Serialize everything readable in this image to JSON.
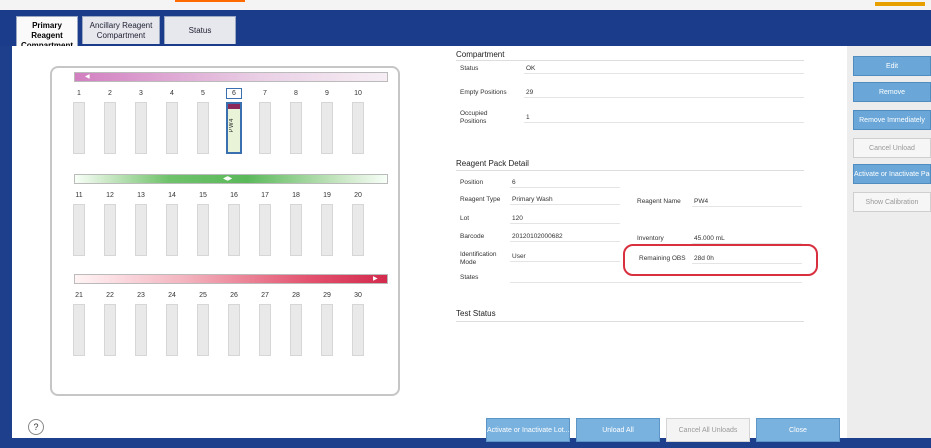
{
  "tabs": [
    {
      "line1": "Primary Reagent",
      "line2": "Compartment",
      "active": true
    },
    {
      "line1": "Ancillary Reagent",
      "line2": "Compartment",
      "active": false
    },
    {
      "line1": "Status",
      "line2": "",
      "active": false
    }
  ],
  "rack": {
    "positions": [
      {
        "n": "1"
      },
      {
        "n": "2"
      },
      {
        "n": "3"
      },
      {
        "n": "4"
      },
      {
        "n": "5"
      },
      {
        "n": "6",
        "label": "PW4",
        "occupied": true
      },
      {
        "n": "7"
      },
      {
        "n": "8"
      },
      {
        "n": "9"
      },
      {
        "n": "10"
      },
      {
        "n": "11"
      },
      {
        "n": "12"
      },
      {
        "n": "13"
      },
      {
        "n": "14"
      },
      {
        "n": "15"
      },
      {
        "n": "16"
      },
      {
        "n": "17"
      },
      {
        "n": "18"
      },
      {
        "n": "19"
      },
      {
        "n": "20"
      },
      {
        "n": "21"
      },
      {
        "n": "22"
      },
      {
        "n": "23"
      },
      {
        "n": "24"
      },
      {
        "n": "25"
      },
      {
        "n": "26"
      },
      {
        "n": "27"
      },
      {
        "n": "28"
      },
      {
        "n": "29"
      },
      {
        "n": "30"
      }
    ]
  },
  "compartment": {
    "title": "Compartment",
    "status_label": "Status",
    "status_value": "OK",
    "empty_label": "Empty Positions",
    "empty_value": "29",
    "occupied_label": "Occupied Positions",
    "occupied_value": "1"
  },
  "detail": {
    "title": "Reagent Pack Detail",
    "position_label": "Position",
    "position_value": "6",
    "type_label": "Reagent Type",
    "type_value": "Primary Wash",
    "name_label": "Reagent Name",
    "name_value": "PW4",
    "lot_label": "Lot",
    "lot_value": "120",
    "barcode_label": "Barcode",
    "barcode_value": "20120102000682",
    "inventory_label": "Inventory",
    "inventory_value": "45.000 mL",
    "ident_label": "Identification Mode",
    "ident_value": "User",
    "remaining_label": "Remaining OBS",
    "remaining_value": "28d 0h",
    "states_label": "States",
    "states_value": ""
  },
  "test_status": {
    "title": "Test Status"
  },
  "sidebar_buttons": [
    {
      "label": "Edit",
      "enabled": true
    },
    {
      "label": "Remove",
      "enabled": true
    },
    {
      "label": "Remove Immediately",
      "enabled": true
    },
    {
      "label": "Cancel Unload",
      "enabled": false
    },
    {
      "label": "Activate or Inactivate Pack",
      "enabled": true
    },
    {
      "label": "Show Calibration",
      "enabled": false
    }
  ],
  "bottom_buttons": [
    {
      "label": "Activate or Inactivate Lot...",
      "enabled": true
    },
    {
      "label": "Unload All",
      "enabled": true
    },
    {
      "label": "Cancel All Unloads",
      "enabled": false
    },
    {
      "label": "Close",
      "enabled": true
    }
  ],
  "help_label": "?",
  "colors": {
    "accent": "#6aa7d8",
    "header": "#1e3f8c",
    "highlight": "#d8303f"
  }
}
